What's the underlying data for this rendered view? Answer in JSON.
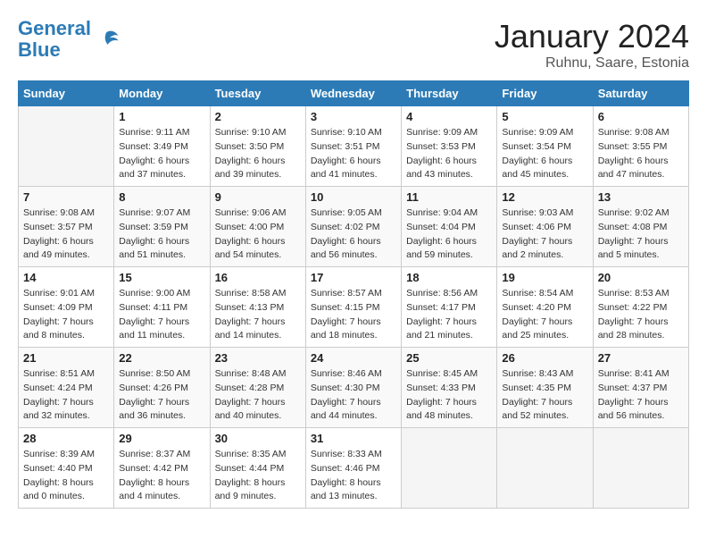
{
  "header": {
    "logo_line1": "General",
    "logo_line2": "Blue",
    "month": "January 2024",
    "location": "Ruhnu, Saare, Estonia"
  },
  "weekdays": [
    "Sunday",
    "Monday",
    "Tuesday",
    "Wednesday",
    "Thursday",
    "Friday",
    "Saturday"
  ],
  "weeks": [
    [
      {
        "day": "",
        "sunrise": "",
        "sunset": "",
        "daylight": ""
      },
      {
        "day": "1",
        "sunrise": "Sunrise: 9:11 AM",
        "sunset": "Sunset: 3:49 PM",
        "daylight": "Daylight: 6 hours and 37 minutes."
      },
      {
        "day": "2",
        "sunrise": "Sunrise: 9:10 AM",
        "sunset": "Sunset: 3:50 PM",
        "daylight": "Daylight: 6 hours and 39 minutes."
      },
      {
        "day": "3",
        "sunrise": "Sunrise: 9:10 AM",
        "sunset": "Sunset: 3:51 PM",
        "daylight": "Daylight: 6 hours and 41 minutes."
      },
      {
        "day": "4",
        "sunrise": "Sunrise: 9:09 AM",
        "sunset": "Sunset: 3:53 PM",
        "daylight": "Daylight: 6 hours and 43 minutes."
      },
      {
        "day": "5",
        "sunrise": "Sunrise: 9:09 AM",
        "sunset": "Sunset: 3:54 PM",
        "daylight": "Daylight: 6 hours and 45 minutes."
      },
      {
        "day": "6",
        "sunrise": "Sunrise: 9:08 AM",
        "sunset": "Sunset: 3:55 PM",
        "daylight": "Daylight: 6 hours and 47 minutes."
      }
    ],
    [
      {
        "day": "7",
        "sunrise": "Sunrise: 9:08 AM",
        "sunset": "Sunset: 3:57 PM",
        "daylight": "Daylight: 6 hours and 49 minutes."
      },
      {
        "day": "8",
        "sunrise": "Sunrise: 9:07 AM",
        "sunset": "Sunset: 3:59 PM",
        "daylight": "Daylight: 6 hours and 51 minutes."
      },
      {
        "day": "9",
        "sunrise": "Sunrise: 9:06 AM",
        "sunset": "Sunset: 4:00 PM",
        "daylight": "Daylight: 6 hours and 54 minutes."
      },
      {
        "day": "10",
        "sunrise": "Sunrise: 9:05 AM",
        "sunset": "Sunset: 4:02 PM",
        "daylight": "Daylight: 6 hours and 56 minutes."
      },
      {
        "day": "11",
        "sunrise": "Sunrise: 9:04 AM",
        "sunset": "Sunset: 4:04 PM",
        "daylight": "Daylight: 6 hours and 59 minutes."
      },
      {
        "day": "12",
        "sunrise": "Sunrise: 9:03 AM",
        "sunset": "Sunset: 4:06 PM",
        "daylight": "Daylight: 7 hours and 2 minutes."
      },
      {
        "day": "13",
        "sunrise": "Sunrise: 9:02 AM",
        "sunset": "Sunset: 4:08 PM",
        "daylight": "Daylight: 7 hours and 5 minutes."
      }
    ],
    [
      {
        "day": "14",
        "sunrise": "Sunrise: 9:01 AM",
        "sunset": "Sunset: 4:09 PM",
        "daylight": "Daylight: 7 hours and 8 minutes."
      },
      {
        "day": "15",
        "sunrise": "Sunrise: 9:00 AM",
        "sunset": "Sunset: 4:11 PM",
        "daylight": "Daylight: 7 hours and 11 minutes."
      },
      {
        "day": "16",
        "sunrise": "Sunrise: 8:58 AM",
        "sunset": "Sunset: 4:13 PM",
        "daylight": "Daylight: 7 hours and 14 minutes."
      },
      {
        "day": "17",
        "sunrise": "Sunrise: 8:57 AM",
        "sunset": "Sunset: 4:15 PM",
        "daylight": "Daylight: 7 hours and 18 minutes."
      },
      {
        "day": "18",
        "sunrise": "Sunrise: 8:56 AM",
        "sunset": "Sunset: 4:17 PM",
        "daylight": "Daylight: 7 hours and 21 minutes."
      },
      {
        "day": "19",
        "sunrise": "Sunrise: 8:54 AM",
        "sunset": "Sunset: 4:20 PM",
        "daylight": "Daylight: 7 hours and 25 minutes."
      },
      {
        "day": "20",
        "sunrise": "Sunrise: 8:53 AM",
        "sunset": "Sunset: 4:22 PM",
        "daylight": "Daylight: 7 hours and 28 minutes."
      }
    ],
    [
      {
        "day": "21",
        "sunrise": "Sunrise: 8:51 AM",
        "sunset": "Sunset: 4:24 PM",
        "daylight": "Daylight: 7 hours and 32 minutes."
      },
      {
        "day": "22",
        "sunrise": "Sunrise: 8:50 AM",
        "sunset": "Sunset: 4:26 PM",
        "daylight": "Daylight: 7 hours and 36 minutes."
      },
      {
        "day": "23",
        "sunrise": "Sunrise: 8:48 AM",
        "sunset": "Sunset: 4:28 PM",
        "daylight": "Daylight: 7 hours and 40 minutes."
      },
      {
        "day": "24",
        "sunrise": "Sunrise: 8:46 AM",
        "sunset": "Sunset: 4:30 PM",
        "daylight": "Daylight: 7 hours and 44 minutes."
      },
      {
        "day": "25",
        "sunrise": "Sunrise: 8:45 AM",
        "sunset": "Sunset: 4:33 PM",
        "daylight": "Daylight: 7 hours and 48 minutes."
      },
      {
        "day": "26",
        "sunrise": "Sunrise: 8:43 AM",
        "sunset": "Sunset: 4:35 PM",
        "daylight": "Daylight: 7 hours and 52 minutes."
      },
      {
        "day": "27",
        "sunrise": "Sunrise: 8:41 AM",
        "sunset": "Sunset: 4:37 PM",
        "daylight": "Daylight: 7 hours and 56 minutes."
      }
    ],
    [
      {
        "day": "28",
        "sunrise": "Sunrise: 8:39 AM",
        "sunset": "Sunset: 4:40 PM",
        "daylight": "Daylight: 8 hours and 0 minutes."
      },
      {
        "day": "29",
        "sunrise": "Sunrise: 8:37 AM",
        "sunset": "Sunset: 4:42 PM",
        "daylight": "Daylight: 8 hours and 4 minutes."
      },
      {
        "day": "30",
        "sunrise": "Sunrise: 8:35 AM",
        "sunset": "Sunset: 4:44 PM",
        "daylight": "Daylight: 8 hours and 9 minutes."
      },
      {
        "day": "31",
        "sunrise": "Sunrise: 8:33 AM",
        "sunset": "Sunset: 4:46 PM",
        "daylight": "Daylight: 8 hours and 13 minutes."
      },
      {
        "day": "",
        "sunrise": "",
        "sunset": "",
        "daylight": ""
      },
      {
        "day": "",
        "sunrise": "",
        "sunset": "",
        "daylight": ""
      },
      {
        "day": "",
        "sunrise": "",
        "sunset": "",
        "daylight": ""
      }
    ]
  ]
}
